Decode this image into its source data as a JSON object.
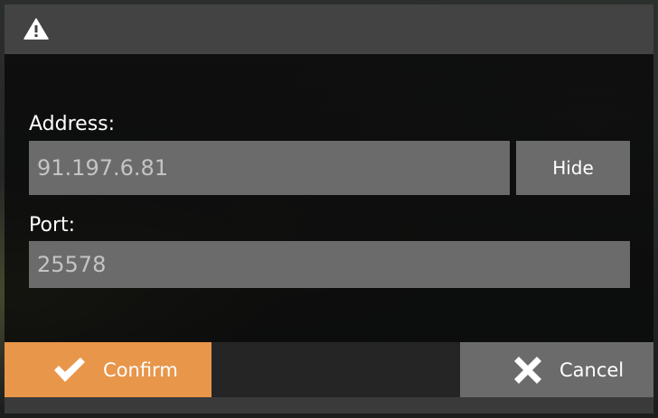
{
  "dialog": {
    "title_icon": "warning-icon",
    "address_label": "Address:",
    "address_value": "91.197.6.81",
    "hide_label": "Hide",
    "port_label": "Port:",
    "port_value": "25578",
    "confirm_label": "Confirm",
    "cancel_label": "Cancel"
  },
  "colors": {
    "accent": "#e8964a",
    "field": "#6b6b6b",
    "titlebar": "#434343"
  }
}
